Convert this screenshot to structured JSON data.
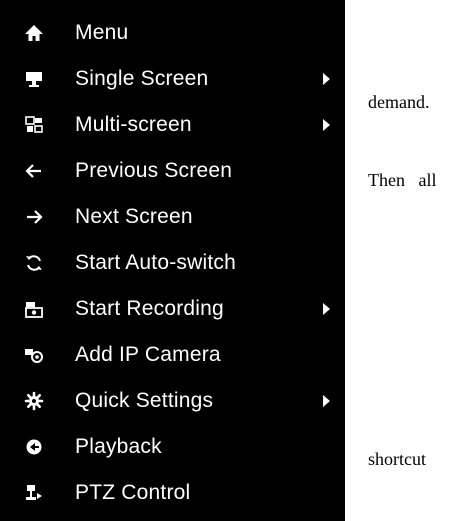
{
  "menu": {
    "items": [
      {
        "label": "Menu",
        "icon": "home-icon",
        "submenu": false
      },
      {
        "label": "Single Screen",
        "icon": "monitor-icon",
        "submenu": true
      },
      {
        "label": "Multi-screen",
        "icon": "multi-screen-icon",
        "submenu": true
      },
      {
        "label": "Previous Screen",
        "icon": "arrow-left-icon",
        "submenu": false
      },
      {
        "label": "Next Screen",
        "icon": "arrow-right-icon",
        "submenu": false
      },
      {
        "label": "Start Auto-switch",
        "icon": "refresh-icon",
        "submenu": false
      },
      {
        "label": "Start Recording",
        "icon": "recording-icon",
        "submenu": true
      },
      {
        "label": "Add IP Camera",
        "icon": "camera-icon",
        "submenu": false
      },
      {
        "label": "Quick Settings",
        "icon": "gear-icon",
        "submenu": true
      },
      {
        "label": "Playback",
        "icon": "playback-icon",
        "submenu": false
      },
      {
        "label": "PTZ Control",
        "icon": "ptz-icon",
        "submenu": false
      }
    ]
  },
  "document": {
    "fragment_1": "demand.",
    "fragment_2": "Then   all",
    "fragment_3": "shortcut"
  }
}
